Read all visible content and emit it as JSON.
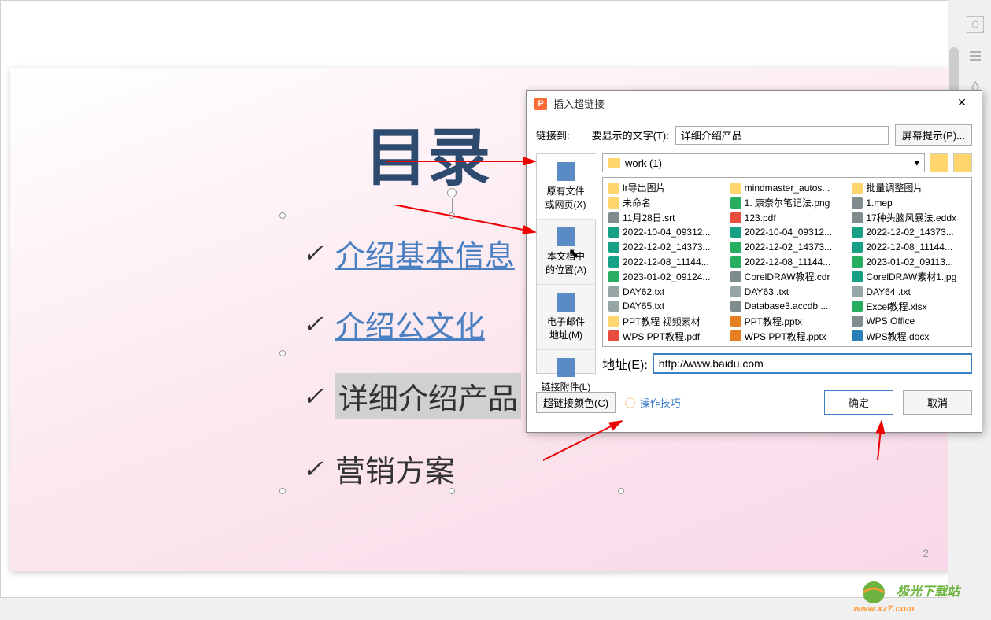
{
  "slide": {
    "title": "目录",
    "items": [
      {
        "text": "介绍基本信息",
        "link": true
      },
      {
        "text": "介绍公文化",
        "link": true
      },
      {
        "text": "详细介绍产品",
        "link": false,
        "selected": true
      },
      {
        "text": "营销方案",
        "link": false
      }
    ],
    "page_number": "2"
  },
  "dialog": {
    "title": "插入超链接",
    "link_to_label": "链接到:",
    "display_text_label": "要显示的文字(T):",
    "display_text_value": "详细介绍产品",
    "screen_tip_btn": "屏幕提示(P)...",
    "nav": [
      {
        "label1": "原有文件",
        "label2": "或网页(X)",
        "active": true
      },
      {
        "label1": "本文档中",
        "label2": "的位置(A)"
      },
      {
        "label1": "电子邮件",
        "label2": "地址(M)"
      },
      {
        "label1": "链接附件(L)",
        "label2": ""
      }
    ],
    "path": "work (1)",
    "files": [
      {
        "n": "lr导出图片",
        "t": "folder"
      },
      {
        "n": "mindmaster_autos...",
        "t": "folder"
      },
      {
        "n": "批量调整图片",
        "t": "folder"
      },
      {
        "n": "未命名",
        "t": "folder"
      },
      {
        "n": "1. 康奈尔笔记法.png",
        "t": "png"
      },
      {
        "n": "1.mep",
        "t": "misc"
      },
      {
        "n": "11月28日.srt",
        "t": "misc"
      },
      {
        "n": "123.pdf",
        "t": "pdf"
      },
      {
        "n": "17种头脑风暴法.eddx",
        "t": "misc"
      },
      {
        "n": "2022-10-04_09312...",
        "t": "jpg"
      },
      {
        "n": "2022-10-04_09312...",
        "t": "jpg"
      },
      {
        "n": "2022-12-02_14373...",
        "t": "jpg"
      },
      {
        "n": "2022-12-02_14373...",
        "t": "jpg"
      },
      {
        "n": "2022-12-02_14373...",
        "t": "png"
      },
      {
        "n": "2022-12-08_11144...",
        "t": "jpg"
      },
      {
        "n": "2022-12-08_11144...",
        "t": "jpg"
      },
      {
        "n": "2022-12-08_11144...",
        "t": "png"
      },
      {
        "n": "2023-01-02_09113...",
        "t": "png"
      },
      {
        "n": "2023-01-02_09124...",
        "t": "png"
      },
      {
        "n": "CorelDRAW教程.cdr",
        "t": "misc"
      },
      {
        "n": "CorelDRAW素材1.jpg",
        "t": "jpg"
      },
      {
        "n": "DAY62.txt",
        "t": "txt"
      },
      {
        "n": "DAY63 .txt",
        "t": "txt"
      },
      {
        "n": "DAY64 .txt",
        "t": "txt"
      },
      {
        "n": "DAY65.txt",
        "t": "txt"
      },
      {
        "n": "Database3.accdb ...",
        "t": "misc"
      },
      {
        "n": "Excel教程.xlsx",
        "t": "xlsx"
      },
      {
        "n": "PPT教程 视频素材",
        "t": "folder"
      },
      {
        "n": "PPT教程.pptx",
        "t": "pptx"
      },
      {
        "n": "WPS Office",
        "t": "misc"
      },
      {
        "n": "WPS PPT教程.pdf",
        "t": "pdf"
      },
      {
        "n": "WPS PPT教程.pptx",
        "t": "pptx"
      },
      {
        "n": "WPS教程.docx",
        "t": "docx"
      }
    ],
    "address_label": "地址(E):",
    "address_value": "http://www.baidu.com",
    "color_btn": "超链接颜色(C)",
    "tips_link": "操作技巧",
    "ok_btn": "确定",
    "cancel_btn": "取消"
  },
  "watermark": {
    "main": "极光下载站",
    "sub": "www.xz7.com"
  }
}
